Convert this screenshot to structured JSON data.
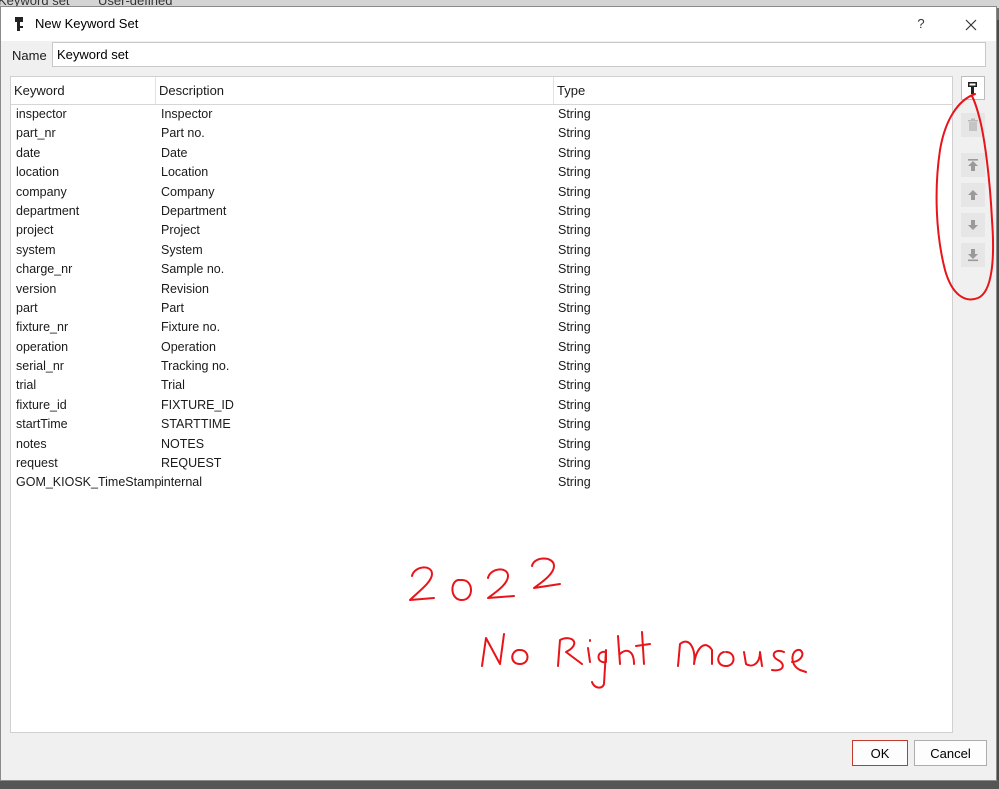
{
  "background": {
    "tab1": "Keyword set",
    "tab2": "User-defined"
  },
  "dialog": {
    "title": "New Keyword Set",
    "help": "?",
    "name_label": "Name",
    "name_value": "Keyword set"
  },
  "table": {
    "columns": [
      "Keyword",
      "Description",
      "Type"
    ],
    "rows": [
      [
        "inspector",
        "Inspector",
        "String"
      ],
      [
        "part_nr",
        "Part no.",
        "String"
      ],
      [
        "date",
        "Date",
        "String"
      ],
      [
        "location",
        "Location",
        "String"
      ],
      [
        "company",
        "Company",
        "String"
      ],
      [
        "department",
        "Department",
        "String"
      ],
      [
        "project",
        "Project",
        "String"
      ],
      [
        "system",
        "System",
        "String"
      ],
      [
        "charge_nr",
        "Sample no.",
        "String"
      ],
      [
        "version",
        "Revision",
        "String"
      ],
      [
        "part",
        "Part",
        "String"
      ],
      [
        "fixture_nr",
        "Fixture no.",
        "String"
      ],
      [
        "operation",
        "Operation",
        "String"
      ],
      [
        "serial_nr",
        "Tracking no.",
        "String"
      ],
      [
        "trial",
        "Trial",
        "String"
      ],
      [
        "fixture_id",
        "FIXTURE_ID",
        "String"
      ],
      [
        "startTime",
        "STARTTIME",
        "String"
      ],
      [
        "notes",
        "NOTES",
        "String"
      ],
      [
        "request",
        "REQUEST",
        "String"
      ],
      [
        "GOM_KIOSK_TimeStamp",
        "internal",
        "String"
      ]
    ]
  },
  "toolbar": {
    "icons": [
      "add-keyword-icon",
      "delete-icon",
      "move-to-top-icon",
      "move-up-icon",
      "move-down-icon",
      "move-to-bottom-icon"
    ]
  },
  "buttons": {
    "ok": "OK",
    "cancel": "Cancel"
  },
  "annotation": {
    "color": "#e8141a",
    "line1": "2022",
    "line2": "No Right mouse"
  }
}
